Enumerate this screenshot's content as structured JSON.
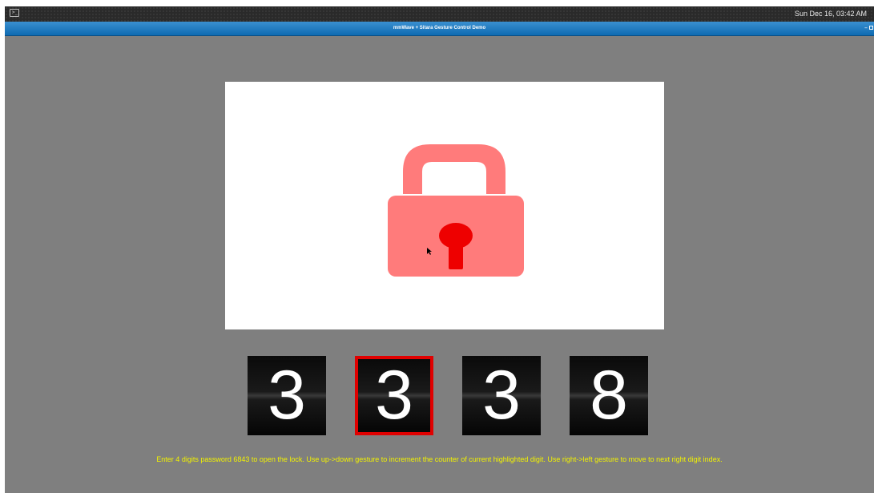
{
  "topbar": {
    "terminal_icon": "terminal-icon",
    "clock": "Sun Dec 16, 03:42 AM"
  },
  "window": {
    "title": "mmWave + Sitara Gesture Control Demo",
    "minimize_label": "–",
    "maximize_icon": "maximize-icon"
  },
  "lock": {
    "icon": "padlock-icon",
    "state": "locked",
    "body_color": "#ff7b7b",
    "keyhole_color": "#ee0000"
  },
  "digits": [
    {
      "value": "3",
      "highlighted": false
    },
    {
      "value": "3",
      "highlighted": true
    },
    {
      "value": "3",
      "highlighted": false
    },
    {
      "value": "8",
      "highlighted": false
    }
  ],
  "highlight_color": "#e00000",
  "instructions": "Enter 4 digits password 6843 to open the lock. Use up->down gesture to increment the counter of current highlighted digit. Use right->left gesture to move to next right digit index."
}
